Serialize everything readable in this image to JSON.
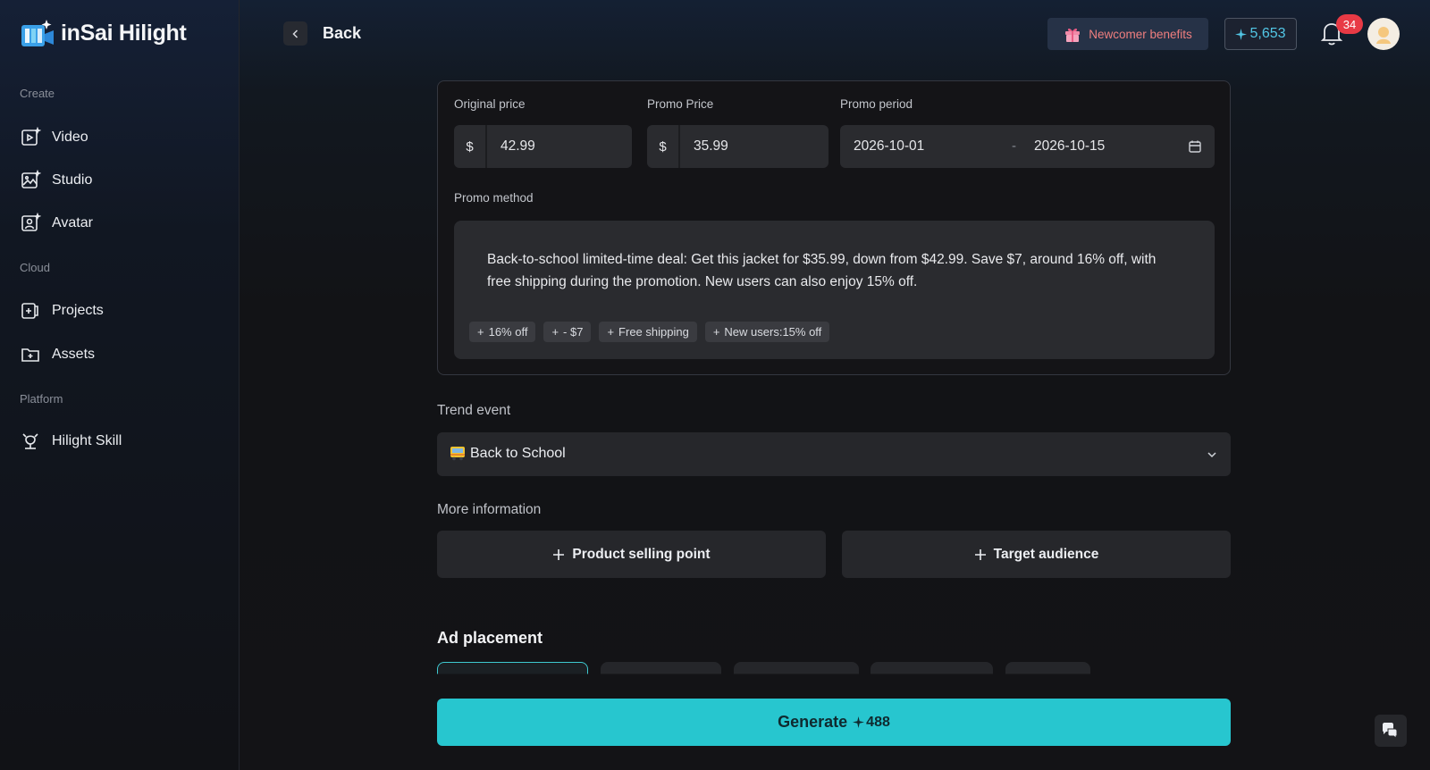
{
  "brand": {
    "name": "inSai Hilight"
  },
  "sidebar": {
    "sections": [
      {
        "label": "Create"
      },
      {
        "label": "Cloud"
      },
      {
        "label": "Platform"
      }
    ],
    "items": [
      {
        "label": "Video",
        "icon": "video-icon"
      },
      {
        "label": "Studio",
        "icon": "image-sparkle-icon"
      },
      {
        "label": "Avatar",
        "icon": "avatar-icon"
      },
      {
        "label": "Projects",
        "icon": "projects-icon"
      },
      {
        "label": "Assets",
        "icon": "folder-plus-icon"
      },
      {
        "label": "Hilight Skill",
        "icon": "skill-icon"
      }
    ]
  },
  "topbar": {
    "back_label": "Back",
    "benefits_label": "Newcomer benefits",
    "credits": "5,653",
    "notifications_count": "34"
  },
  "promo": {
    "original_price_label": "Original price",
    "original_price_prefix": "$",
    "original_price_value": "42.99",
    "promo_price_label": "Promo Price",
    "promo_price_prefix": "$",
    "promo_price_value": "35.99",
    "period_label": "Promo period",
    "period_start": "2026-10-01",
    "period_separator": "-",
    "period_end": "2026-10-15",
    "method_label": "Promo method",
    "method_text": "Back-to-school limited-time deal: Get this jacket for $35.99, down from $42.99. Save $7, around 16% off, with free shipping during the promotion. New users can also enjoy 15% off.",
    "chips": [
      "16% off",
      "- $7",
      "Free shipping",
      "New users:15% off"
    ]
  },
  "trend": {
    "label": "Trend event",
    "value": "Back to School"
  },
  "more_info": {
    "label": "More information",
    "selling_point_label": "Product selling point",
    "audience_label": "Target audience"
  },
  "ad_placement": {
    "title": "Ad placement"
  },
  "generate": {
    "label": "Generate",
    "cost": "488"
  },
  "colors": {
    "accent": "#27c6cf",
    "badge": "#e83a45",
    "credits": "#52c7e6",
    "benefits": "#f07f7f"
  }
}
